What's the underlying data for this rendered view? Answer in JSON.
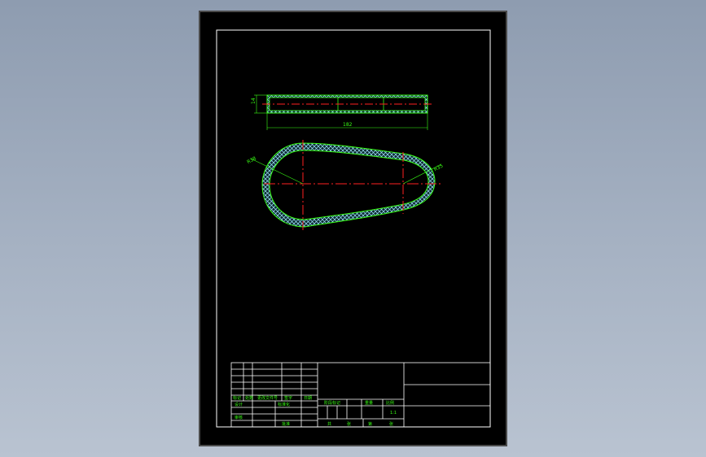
{
  "drawing": {
    "dim_thickness": "14",
    "dim_length": "182",
    "dim_large_radius": "R38",
    "dim_small_radius": "R35"
  },
  "title_block": {
    "row_labels": [
      "标记",
      "处数",
      "更改文件号",
      "签字",
      "日期"
    ],
    "left_row_designer": "设计",
    "left_row_standard": "标准化",
    "left_row_reviewer": "审核",
    "left_row_approve": "批准",
    "stage_headers": [
      "阶段标记",
      "重量",
      "比例"
    ],
    "scale_value": "1:1",
    "sheet_total": "共",
    "sheet_label": "张",
    "sheet_no": "第",
    "sheet_label2": "张"
  },
  "colors": {
    "sheet_bg": "#000000",
    "frame": "#ffffff",
    "outline": "#39ff14",
    "hatch": "#9fe8ff",
    "centerline": "#ff2020",
    "dimension": "#39ff14",
    "text": "#39ff14"
  }
}
